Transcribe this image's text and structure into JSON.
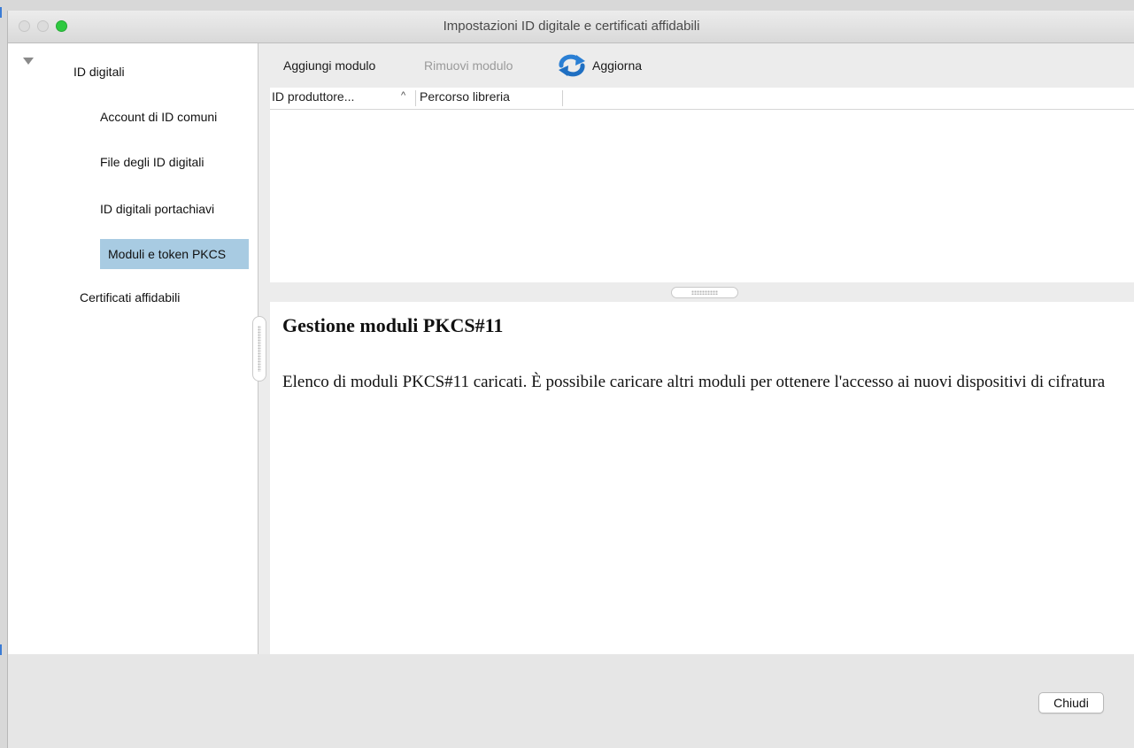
{
  "window": {
    "title": "Impostazioni ID digitale e certificati affidabili"
  },
  "sidebar": {
    "items": [
      {
        "label": "ID digitali",
        "level": 0,
        "expanded": true
      },
      {
        "label": "Account di ID comuni",
        "level": 1
      },
      {
        "label": "File degli ID digitali",
        "level": 1
      },
      {
        "label": "ID digitali portachiavi",
        "level": 1
      },
      {
        "label": "Moduli e token PKCS",
        "level": 1,
        "selected": true
      },
      {
        "label": "Certificati affidabili",
        "level": 0
      }
    ]
  },
  "toolbar": {
    "add_label": "Aggiungi modulo",
    "remove_label": "Rimuovi modulo",
    "refresh_label": "Aggiorna"
  },
  "table": {
    "columns": [
      "ID produttore...",
      "Percorso libreria"
    ],
    "sort_column": "ID produttore...",
    "sort_direction": "ascending",
    "rows": []
  },
  "details": {
    "heading": "Gestione moduli PKCS#11",
    "body": "Elenco di moduli PKCS#11 caricati. È possibile caricare altri moduli per ottenere l'accesso ai nuovi dispositivi di cifratura"
  },
  "footer": {
    "close_label": "Chiudi"
  },
  "colors": {
    "selection": "#a8cbe2",
    "refresh_icon": "#2a7fd4",
    "zoom_button": "#2ec940"
  }
}
